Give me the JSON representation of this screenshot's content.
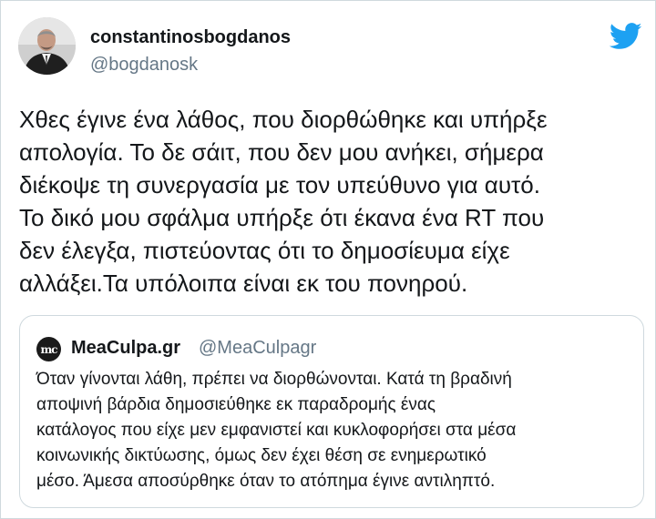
{
  "author": {
    "display_name": "constantinosbogdanos",
    "handle": "@bogdanosk",
    "avatar_icon": "profile-photo"
  },
  "brand": {
    "icon": "twitter-bird-icon",
    "color": "#1da1f2"
  },
  "tweet": {
    "text": "Χθες έγινε ένα λάθος, που διορθώθηκε και υπήρξε\nαπολογία. Το δε σάιτ, που δεν μου ανήκει, σήμερα\nδιέκοψε τη συνεργασία με τον υπεύθυνο για αυτό.\nΤο δικό μου σφάλμα υπήρξε ότι έκανα ένα RT που\nδεν έλεγξα, πιστεύοντας ότι το δημοσίευμα είχε\nαλλάξει.Τα υπόλοιπα είναι εκ του πονηρού."
  },
  "quoted_tweet": {
    "logo_text": "mc",
    "display_name": "MeaCulpa.gr",
    "handle": "@MeaCulpagr",
    "text": "Όταν γίνονται λάθη, πρέπει να διορθώνονται. Κατά τη βραδινή\nαποψινή βάρδια δημοσιεύθηκε εκ παραδρομής ένας\nκατάλογος που είχε μεν εμφανιστεί και κυκλοφορήσει στα μέσα\nκοινωνικής δικτύωσης, όμως δεν έχει θέση σε ενημερωτικό\nμέσο. Άμεσα αποσύρθηκε όταν το ατόπημα έγινε αντιληπτό."
  }
}
